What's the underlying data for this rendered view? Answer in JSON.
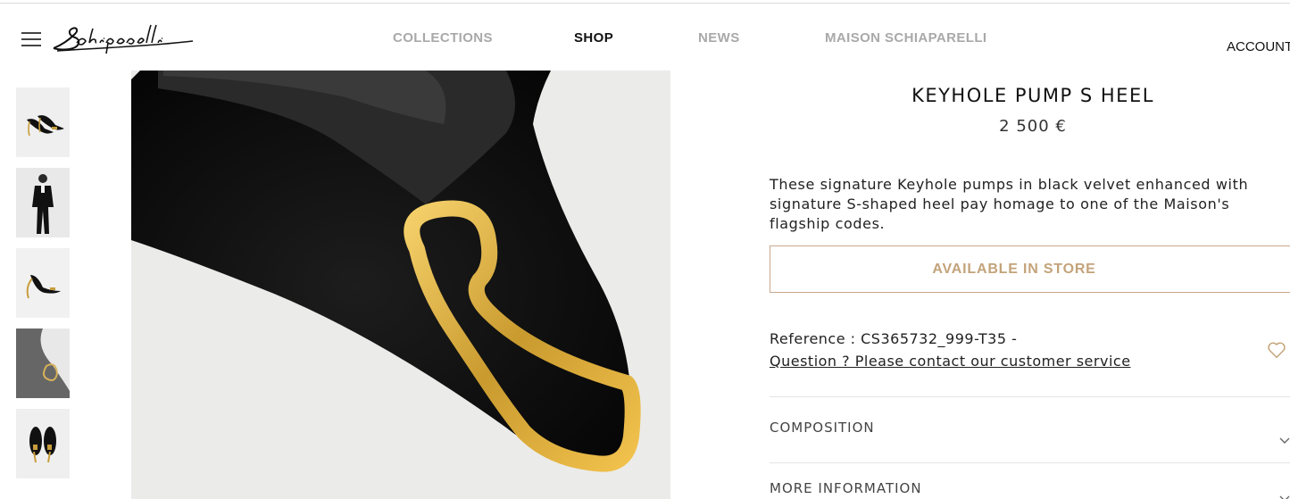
{
  "header": {
    "logo_text": "Schiaparelli",
    "nav": [
      "COLLECTIONS",
      "SHOP",
      "NEWS",
      "MAISON SCHIAPARELLI"
    ],
    "active_nav": "SHOP",
    "account_label": "ACCOUNT"
  },
  "gallery": {
    "thumbnails": [
      "pumps-pair-side",
      "model-black-suit",
      "pump-side-profile",
      "pump-front-closeup",
      "pumps-pair-front"
    ]
  },
  "product": {
    "title": "KEYHOLE PUMP S HEEL",
    "price": "2 500 €",
    "description": "These signature Keyhole pumps in black velvet enhanced with signature S-shaped heel pay homage to one of the Maison's flagship codes.",
    "availability_button": "AVAILABLE IN STORE",
    "reference": "Reference : CS365732_999-T35 -",
    "question_link": "Question ? Please contact our customer service",
    "accordions": [
      "COMPOSITION",
      "MORE INFORMATION"
    ]
  },
  "colors": {
    "accent_gold": "#c3a37a",
    "button_border": "#c9a98c",
    "nav_inactive": "#a9a9a9"
  },
  "icons": [
    "menu-icon",
    "heart-icon",
    "chevron-down-icon"
  ]
}
